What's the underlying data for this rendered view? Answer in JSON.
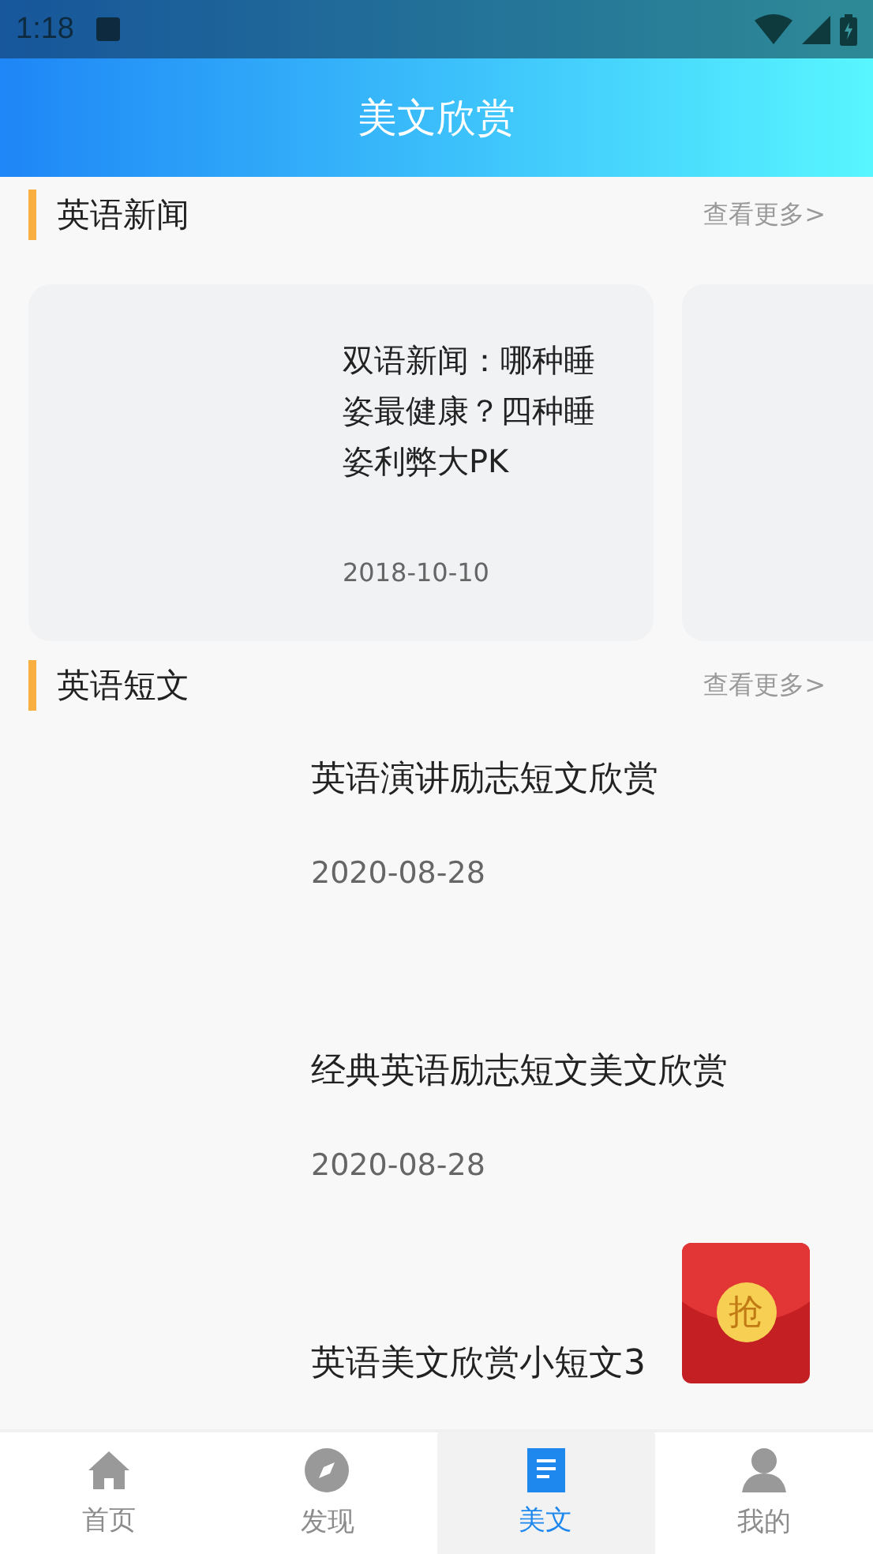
{
  "status_bar": {
    "time": "1:18"
  },
  "header": {
    "title": "美文欣赏"
  },
  "news": {
    "title": "英语新闻",
    "more": "查看更多>",
    "items": [
      {
        "kind": "article",
        "title": "双语新闻：哪种睡姿最健康？四种睡姿利弊大PK",
        "date": "2018-10-10"
      },
      {
        "kind": "empty"
      }
    ]
  },
  "essays": {
    "title": "英语短文",
    "more": "查看更多>",
    "items": [
      {
        "title": "英语演讲励志短文欣赏",
        "date": "2020-08-28"
      },
      {
        "title": "经典英语励志短文美文欣赏",
        "date": "2020-08-28"
      },
      {
        "title": "英语美文欣赏小短文3"
      }
    ]
  },
  "red_packet": {
    "label": "抢"
  },
  "tabs": [
    {
      "label": "首页",
      "kind": "home",
      "selected": false
    },
    {
      "label": "发现",
      "kind": "compass",
      "selected": false
    },
    {
      "label": "美文",
      "kind": "doc",
      "selected": true
    },
    {
      "label": "我的",
      "kind": "person",
      "selected": false
    }
  ]
}
